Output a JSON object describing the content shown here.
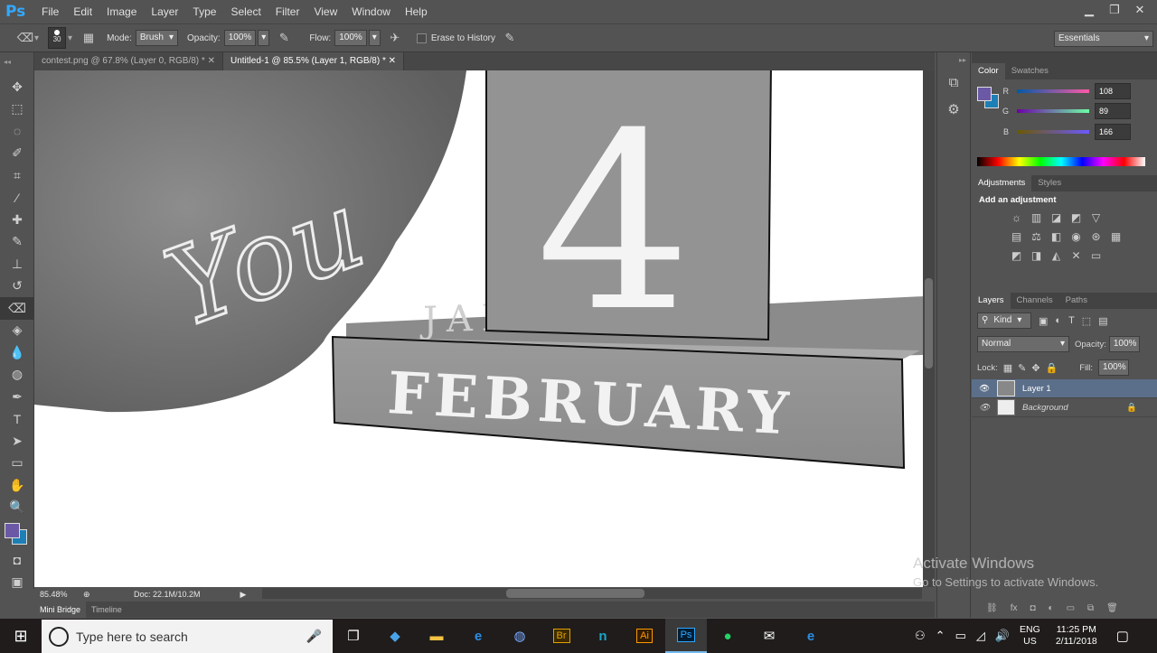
{
  "app": {
    "logo": "Ps"
  },
  "menu": [
    "File",
    "Edit",
    "Image",
    "Layer",
    "Type",
    "Select",
    "Filter",
    "View",
    "Window",
    "Help"
  ],
  "window_controls": {
    "minimize": "minimize-icon",
    "restore": "restore-icon",
    "close": "close-icon"
  },
  "options": {
    "brush_size": "30",
    "mode_label": "Mode:",
    "mode_value": "Brush",
    "opacity_label": "Opacity:",
    "opacity_value": "100%",
    "flow_label": "Flow:",
    "flow_value": "100%",
    "erase_history": "Erase to History",
    "workspace": "Essentials"
  },
  "tabs": [
    {
      "label": "contest.png @ 67.8% (Layer 0, RGB/8) *",
      "active": false
    },
    {
      "label": "Untitled-1 @ 85.5% (Layer 1, RGB/8) *",
      "active": true
    }
  ],
  "canvas": {
    "digit": "4",
    "month_main": "FEBRUARY",
    "month_behind": "JANUARY",
    "pillow_text": "You"
  },
  "status": {
    "zoom": "85.48%",
    "doc": "Doc: 22.1M/10.2M"
  },
  "bottom_tabs": [
    "Mini Bridge",
    "Timeline"
  ],
  "color_panel": {
    "tabs": [
      "Color",
      "Swatches"
    ],
    "r_label": "R",
    "r": "108",
    "g_label": "G",
    "g": "89",
    "b_label": "B",
    "b": "166",
    "foreground": "#6c59a6",
    "background": "#1d7fb5"
  },
  "adjustments": {
    "tabs": [
      "Adjustments",
      "Styles"
    ],
    "heading": "Add an adjustment"
  },
  "layers_panel": {
    "tabs": [
      "Layers",
      "Channels",
      "Paths"
    ],
    "kind": "Kind",
    "blend": "Normal",
    "opacity_label": "Opacity:",
    "opacity": "100%",
    "lock_label": "Lock:",
    "fill_label": "Fill:",
    "fill": "100%",
    "layers": [
      {
        "name": "Layer 1",
        "selected": true
      },
      {
        "name": "Background",
        "selected": false,
        "locked": true
      }
    ]
  },
  "watermark": {
    "line1": "Activate Windows",
    "line2": "Go to Settings to activate Windows."
  },
  "taskbar": {
    "search_placeholder": "Type here to search",
    "lang": "ENG",
    "region": "US",
    "time": "11:25 PM",
    "date": "2/11/2018",
    "app_badges": [
      "Br",
      "Ai",
      "Ps"
    ]
  }
}
